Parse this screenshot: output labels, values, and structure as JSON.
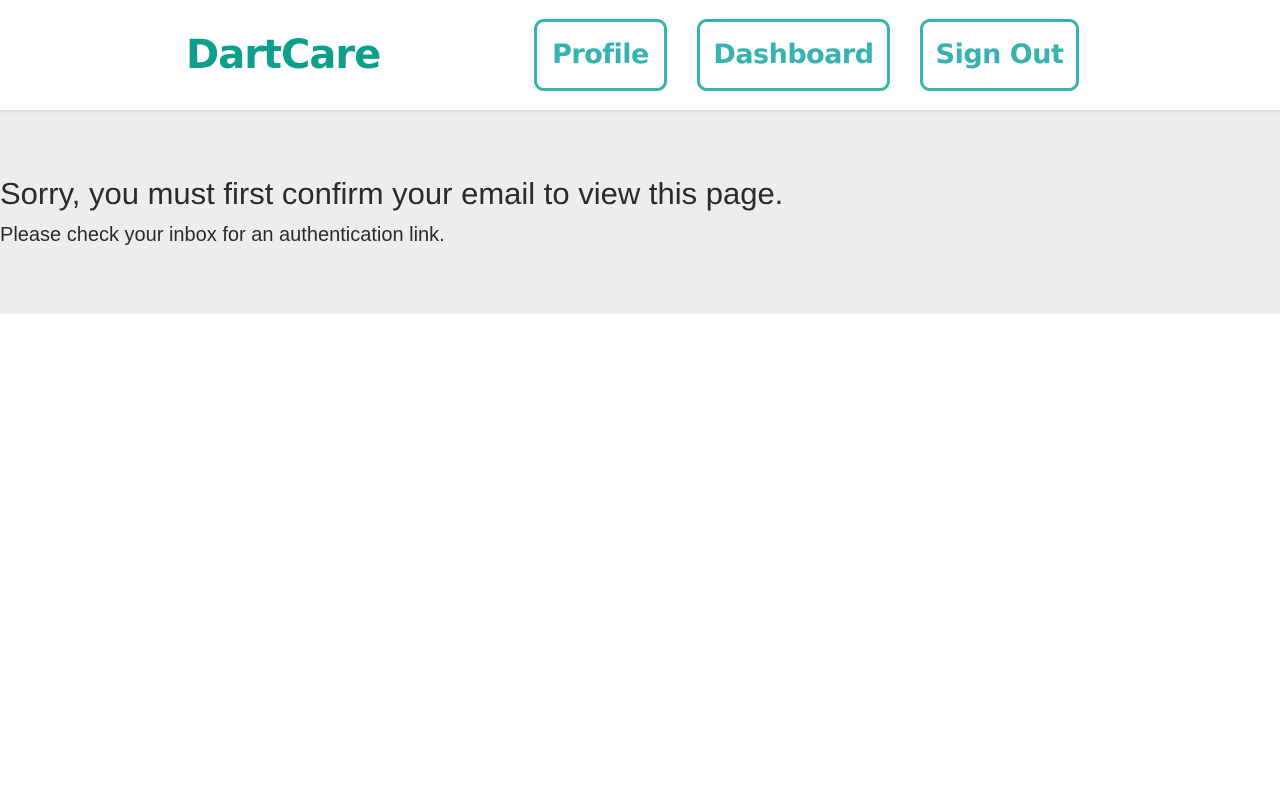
{
  "brand": {
    "name": "DartCare",
    "color": "#0e9f8c"
  },
  "nav": {
    "accent_color": "#36b3b0",
    "items": [
      {
        "label": "Profile"
      },
      {
        "label": "Dashboard"
      },
      {
        "label": "Sign Out"
      }
    ]
  },
  "notice": {
    "title": "Sorry, you must first confirm your email to view this page.",
    "message": "Please check your inbox for an authentication link.",
    "background": "#ededed"
  }
}
